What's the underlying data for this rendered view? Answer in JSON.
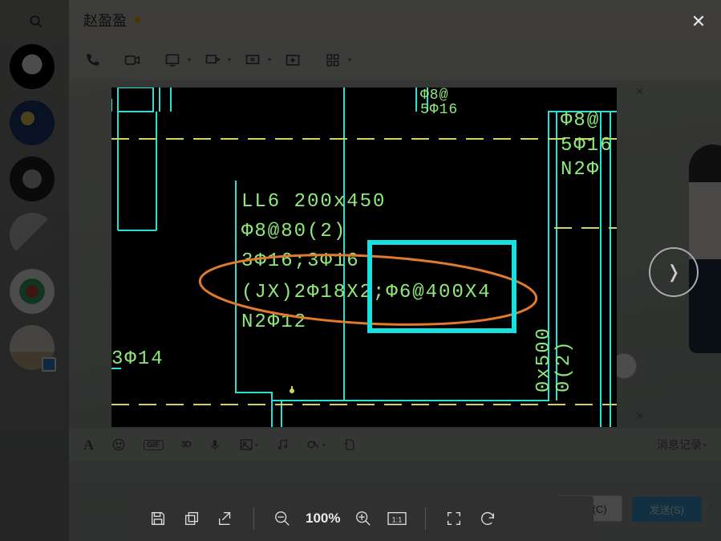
{
  "contact": {
    "name": "赵盈盈"
  },
  "send_buttons": {
    "close": "关闭(C)",
    "send": "发送(S)"
  },
  "history_label": "消息记录",
  "cad_text": {
    "l1": "LL6 200x450",
    "l2": "Φ8@80(2)",
    "l3": "3Φ16;3Φ16",
    "l4": "(JX)2Φ18X2;Φ6@400X4",
    "l5": "N2Φ12",
    "left_small": "3Φ14",
    "top_partial_a": "Φ8@",
    "top_partial_b": "5Φ16",
    "right_a": "Φ8@",
    "right_b": "5Φ16",
    "right_c": "N2Φ",
    "right_d1": "0x500",
    "right_d2": "0(2)"
  },
  "viewer": {
    "zoom": "100%"
  }
}
